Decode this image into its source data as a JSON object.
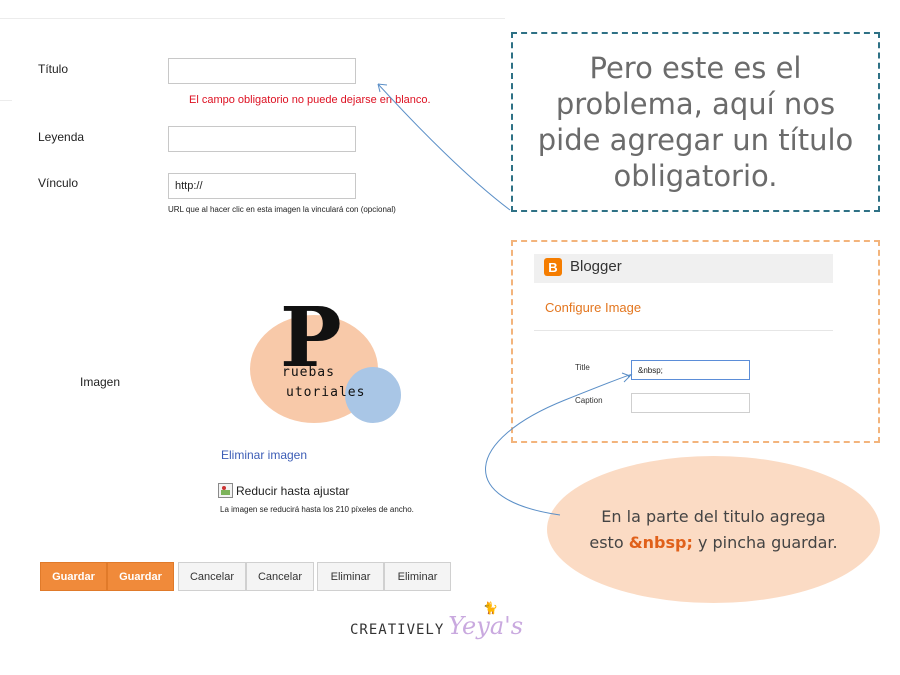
{
  "form": {
    "title_label": "Título",
    "title_value": "",
    "error_text": "El campo obligatorio no puede dejarse en blanco.",
    "legend_label": "Leyenda",
    "legend_value": "",
    "link_label": "Vínculo",
    "link_value": "http://",
    "link_hint": "URL que al hacer clic en esta imagen la vinculará con (opcional)",
    "image_label": "Imagen",
    "remove_image": "Eliminar imagen",
    "resize_label": "Reducir hasta ajustar",
    "resize_hint": "La imagen se reducirá hasta los 210 píxeles de ancho."
  },
  "logo": {
    "big_letter": "P",
    "line1": "ruebas",
    "line2": "utoriales"
  },
  "buttons": {
    "save1": "Guardar",
    "save2": "Guardar",
    "cancel1": "Cancelar",
    "cancel2": "Cancelar",
    "delete1": "Eliminar",
    "delete2": "Eliminar"
  },
  "callout_top": "Pero este es el problema, aquí nos pide agregar un título obligatorio.",
  "blogger": {
    "name": "Blogger",
    "icon_letter": "B",
    "configure": "Configure Image",
    "title_label": "Title",
    "title_value": "&nbsp;",
    "caption_label": "Caption",
    "caption_value": ""
  },
  "note": {
    "before": "En la parte del titulo agrega esto ",
    "code": "&nbsp;",
    "after": " y pincha guardar."
  },
  "brand": {
    "part1": "CREATIVELY",
    "part2": "Yeya's"
  },
  "colors": {
    "accent": "#f08a3a",
    "error": "#dd1122",
    "link": "#3c5db6",
    "callout_border": "#2e7185",
    "panel_border": "#f3b47c",
    "note_bg": "#fbdbc4"
  },
  "icons": {
    "blogger": "blogger-icon",
    "broken_image": "broken-image-icon",
    "cat": "cat-icon"
  }
}
